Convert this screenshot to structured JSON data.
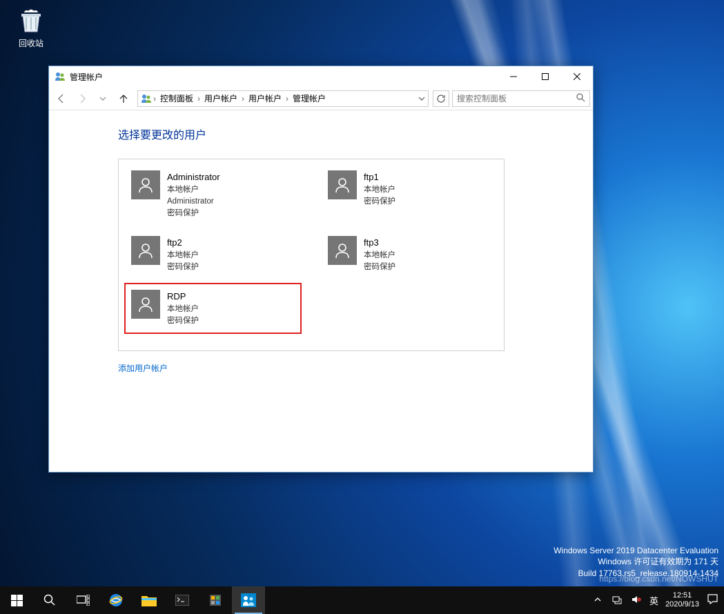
{
  "desktop": {
    "recycle_bin_label": "回收站"
  },
  "window": {
    "title": "管理帐户",
    "breadcrumb": [
      "控制面板",
      "用户帐户",
      "用户帐户",
      "管理帐户"
    ],
    "search_placeholder": "搜索控制面板",
    "heading": "选择要更改的用户",
    "add_user_label": "添加用户帐户",
    "users": [
      {
        "name": "Administrator",
        "lines": [
          "本地帐户",
          "Administrator",
          "密码保护"
        ],
        "highlighted": false
      },
      {
        "name": "ftp1",
        "lines": [
          "本地帐户",
          "密码保护"
        ],
        "highlighted": false
      },
      {
        "name": "ftp2",
        "lines": [
          "本地帐户",
          "密码保护"
        ],
        "highlighted": false
      },
      {
        "name": "ftp3",
        "lines": [
          "本地帐户",
          "密码保护"
        ],
        "highlighted": false
      },
      {
        "name": "RDP",
        "lines": [
          "本地帐户",
          "密码保护"
        ],
        "highlighted": true
      }
    ]
  },
  "build_info": {
    "line1": "Windows Server 2019 Datacenter Evaluation",
    "line2": "Windows 许可证有效期为 171 天",
    "line3": "Build 17763.rs5_release.180914-1434"
  },
  "watermark": "https://blog.csdn.net/NOWSHUT",
  "taskbar": {
    "ime": "英",
    "time": "12:51",
    "date": "2020/9/13"
  }
}
